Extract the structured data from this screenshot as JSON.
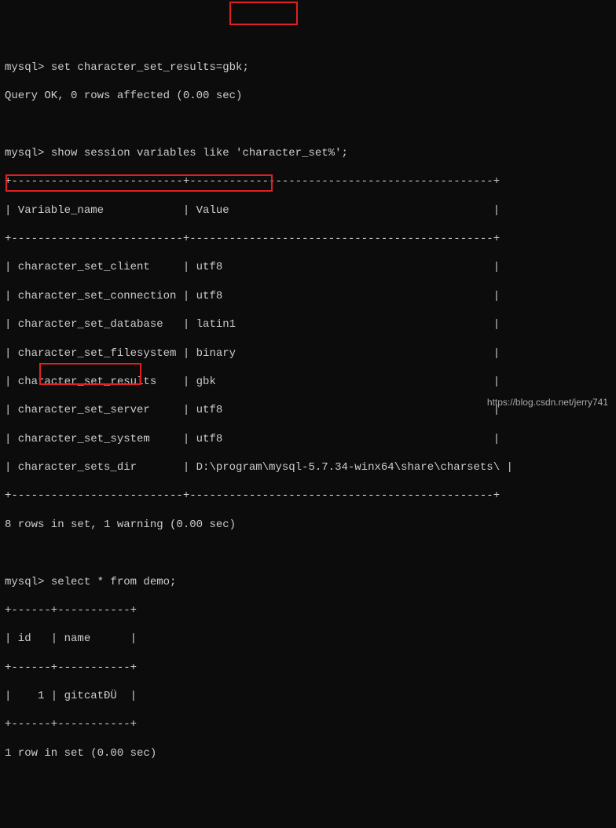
{
  "prompt": "mysql> ",
  "cmd1": "set character_set_results=gbk;",
  "resp1": "Query OK, 0 rows affected (0.00 sec)",
  "cmd2": "show session variables like 'character_set%';",
  "table1": {
    "border_top": "+--------------------------+----------------------------------------------+",
    "header": "| Variable_name            | Value                                        |",
    "border_mid": "+--------------------------+----------------------------------------------+",
    "rows": [
      "| character_set_client     | utf8                                         |",
      "| character_set_connection | utf8                                         |",
      "| character_set_database   | latin1                                       |",
      "| character_set_filesystem | binary                                       |",
      "| character_set_results    | gbk                                          |",
      "| character_set_server     | utf8                                         |",
      "| character_set_system     | utf8                                         |",
      "| character_sets_dir       | D:\\program\\mysql-5.7.34-winx64\\share\\charsets\\ |"
    ],
    "border_bot": "+--------------------------+----------------------------------------------+"
  },
  "resp2": "8 rows in set, 1 warning (0.00 sec)",
  "cmd3": "select * from demo;",
  "table2": {
    "border_top": "+------+-----------+",
    "header": "| id   | name      |",
    "border_mid": "+------+-----------+",
    "row": "|    1 | gitcatÐÜ  |",
    "border_bot": "+------+-----------+"
  },
  "resp3": "1 row in set (0.00 sec)",
  "watermark": "https://blog.csdn.net/jerry741"
}
